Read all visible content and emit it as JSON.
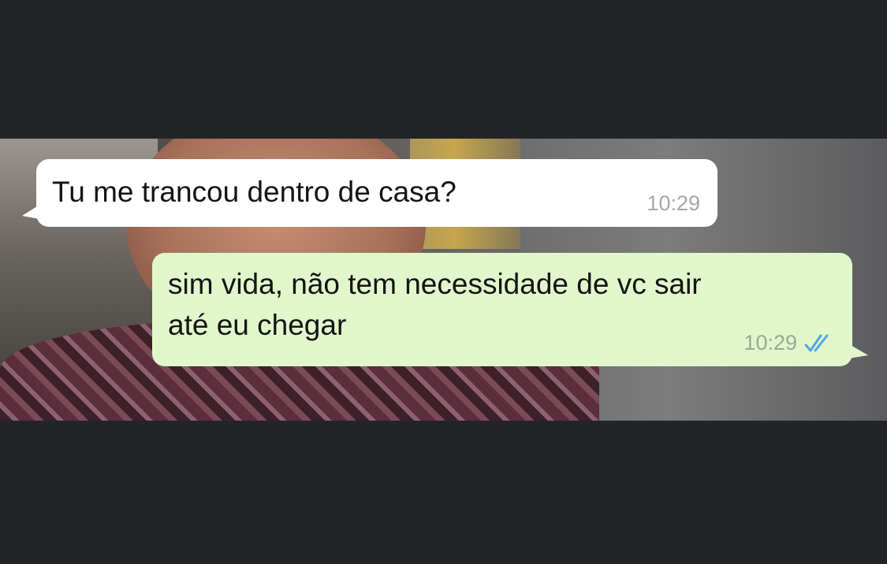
{
  "conversation": {
    "messages": [
      {
        "direction": "incoming",
        "text": "Tu me trancou dentro de casa?",
        "time": "10:29"
      },
      {
        "direction": "outgoing",
        "text": "sim vida, não tem necessidade de vc sair\naté eu chegar",
        "time": "10:29",
        "status_icon": "double-check-read-icon"
      }
    ]
  },
  "colors": {
    "frame_background": "#232426",
    "incoming_bubble": "#ffffff",
    "outgoing_bubble": "#e1f7cb",
    "read_ticks": "#4fa8e8",
    "timestamp": "#a7a7a7"
  }
}
